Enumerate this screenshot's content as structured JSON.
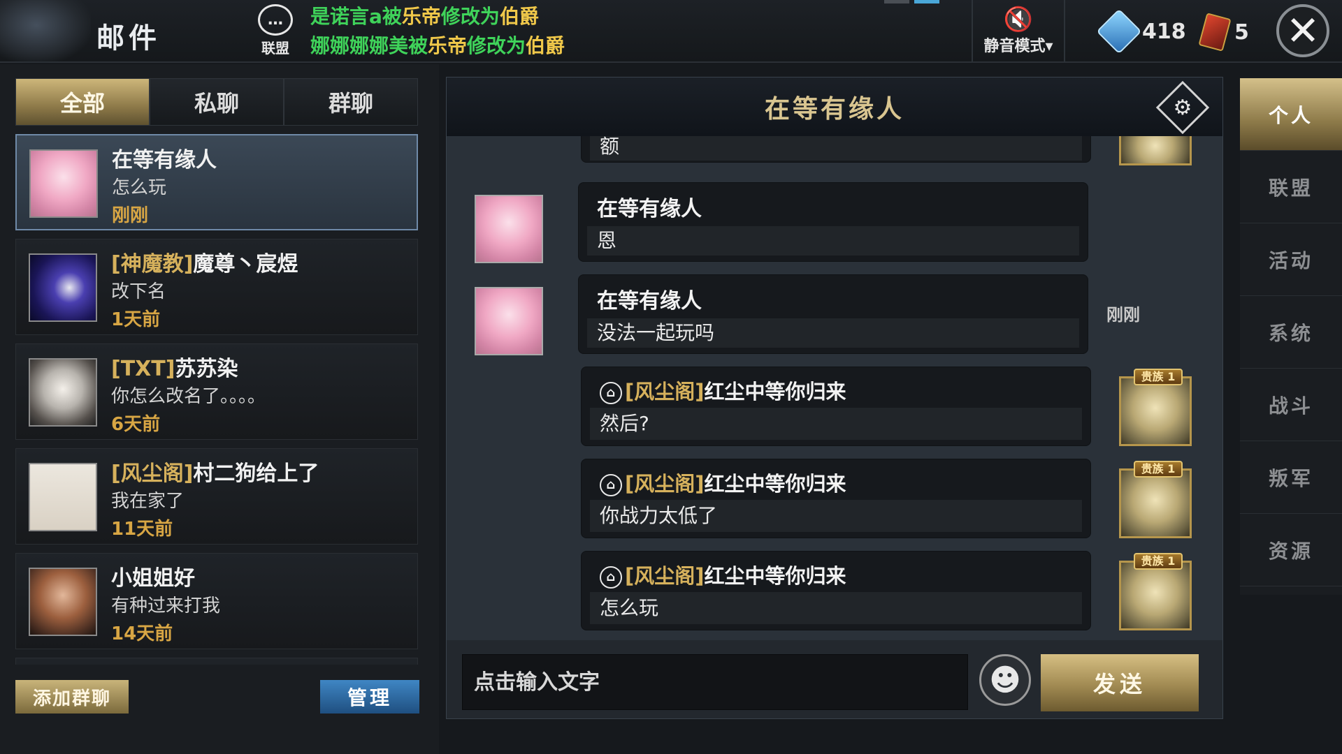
{
  "header": {
    "title": "邮件",
    "alliance_label": "联盟",
    "notice1": {
      "a": "是诺言a被",
      "b": "乐帝",
      "c": "修改为",
      "d": "伯爵"
    },
    "notice2": {
      "a": "娜娜娜娜美被",
      "b": "乐帝",
      "c": "修改为",
      "d": "伯爵"
    },
    "mute_label": "静音模式▾",
    "crystal_count": "418",
    "card_count": "5",
    "colors": {
      "notice_green": "#3fd35a",
      "notice_highlight": "#f0c84a"
    }
  },
  "tabs": [
    {
      "label": "全部",
      "active": true
    },
    {
      "label": "私聊",
      "active": false
    },
    {
      "label": "群聊",
      "active": false
    }
  ],
  "conversations": [
    {
      "tag": "",
      "name": "在等有缘人",
      "message": "怎么玩",
      "time": "刚刚",
      "avatar": "anime-girl-avatar",
      "active": true
    },
    {
      "tag": "[神魔教]",
      "name": "魔尊丶宸煜",
      "message": "改下名",
      "time": "1天前",
      "avatar": "night-figure-avatar"
    },
    {
      "tag": "[TXT]",
      "name": "苏苏染",
      "message": "你怎么改名了。。。。",
      "time": "6天前",
      "avatar": "old-man-avatar"
    },
    {
      "tag": "[风尘阁]",
      "name": "村二狗给上了",
      "message": "我在家了",
      "time": "11天前",
      "avatar": "sketch-avatar"
    },
    {
      "tag": "",
      "name": "小姐姐好",
      "message": "有种过来打我",
      "time": "14天前",
      "avatar": "warrior-woman-avatar"
    }
  ],
  "left_buttons": {
    "add_group": "添加群聊",
    "manage": "管理"
  },
  "chat": {
    "title": "在等有缘人",
    "partial_top_text": "额",
    "messages": [
      {
        "side": "left",
        "name": "在等有缘人",
        "text": "恩"
      },
      {
        "side": "left",
        "name": "在等有缘人",
        "text": "没法一起玩吗"
      },
      {
        "side": "right",
        "guild_tag": "[风尘阁]",
        "name": "红尘中等你归来",
        "text": "然后?",
        "badge": "贵族 1"
      },
      {
        "side": "right",
        "guild_tag": "[风尘阁]",
        "name": "红尘中等你归来",
        "text": "你战力太低了",
        "badge": "贵族 1"
      },
      {
        "side": "right",
        "guild_tag": "[风尘阁]",
        "name": "红尘中等你归来",
        "text": "怎么玩",
        "badge": "贵族 1"
      }
    ],
    "time_label": "刚刚",
    "input_placeholder": "点击输入文字",
    "send_label": "发送"
  },
  "right_nav": [
    {
      "label": "个人",
      "active": true
    },
    {
      "label": "联盟"
    },
    {
      "label": "活动"
    },
    {
      "label": "系统"
    },
    {
      "label": "战斗"
    },
    {
      "label": "叛军"
    },
    {
      "label": "资源"
    }
  ]
}
